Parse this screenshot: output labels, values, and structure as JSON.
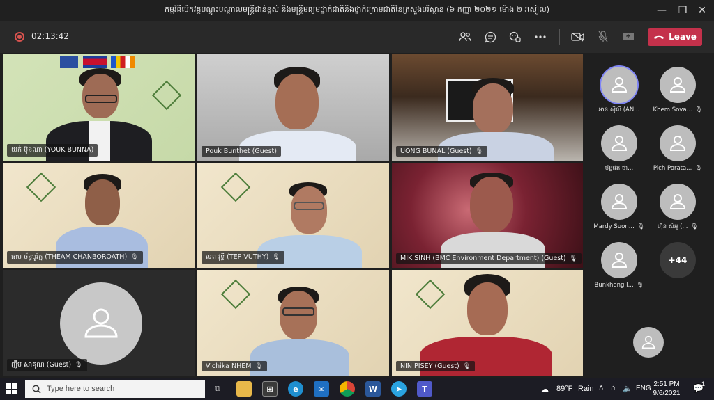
{
  "window": {
    "title": "កម្មវិធីបើកវគ្គបណ្តុះបណ្តាលមន្ត្រីជាន់ខ្ពស់ និងមន្ត្រីមធ្យមថ្នាក់ជាតិនិងថ្នាក់ក្រោមជាតិនៃក្រសួងបរិស្ថាន (៦ កញ្ញា ២០២១ ម៉ោង ២ រសៀល)",
    "controls": {
      "minimize": "—",
      "maximize": "❐",
      "close": "✕"
    }
  },
  "toolbar": {
    "timer": "02:13:42",
    "leave_label": "Leave",
    "icons": [
      "people-icon",
      "chat-icon",
      "reactions-icon",
      "more-icon",
      "camera-off-icon",
      "mic-off-icon",
      "share-icon"
    ]
  },
  "tiles": [
    {
      "name": "យក់ ប៊ុនណា (YOUK BUNNA)",
      "muted": false
    },
    {
      "name": "Pouk Bunthet (Guest)",
      "muted": false
    },
    {
      "name": "UONG BUNAL (Guest)",
      "muted": true
    },
    {
      "name": "ធាម ច័ន្ទបូរ័ត្ន (THEAM CHANBOROATH)",
      "muted": true
    },
    {
      "name": "ទេព វុទ្ធី (TEP VUTHY)",
      "muted": true
    },
    {
      "name": "MIK SINH (BMC Environment Department) (Guest)",
      "muted": true
    },
    {
      "name": "ញឹម សាគុណ (Guest)",
      "muted": true
    },
    {
      "name": "Vichika NHEM",
      "muted": true
    },
    {
      "name": "NIN PISEY (Guest)",
      "muted": true
    }
  ],
  "participants": [
    {
      "name": "អាន ស៊ីលី (AN...",
      "muted": false
    },
    {
      "name": "Khem Sova...",
      "muted": true
    },
    {
      "name": "ច័ន្ទវេត ថា...",
      "muted": false
    },
    {
      "name": "Pich Porata...",
      "muted": true
    },
    {
      "name": "Mardy Suon...",
      "muted": true
    },
    {
      "name": "ហ៊ីន សំអូ (...",
      "muted": true
    },
    {
      "name": "Bunkheng I...",
      "muted": true
    }
  ],
  "more_participants": "+44",
  "taskbar": {
    "search_placeholder": "Type here to search",
    "weather_temp": "89°F",
    "weather_desc": "Rain",
    "lang": "ENG",
    "time": "2:51 PM",
    "date": "9/6/2021",
    "notifications": "1",
    "apps": [
      "task-view-icon",
      "file-explorer-icon",
      "store-icon",
      "edge-icon",
      "mail-icon",
      "chrome-icon",
      "word-icon",
      "telegram-icon",
      "teams-icon"
    ]
  },
  "colors": {
    "leave": "#c4314b",
    "active_ring": "#7f85f5",
    "toolbar_bg": "#292929",
    "taskbar_bg": "#1c1c24"
  }
}
